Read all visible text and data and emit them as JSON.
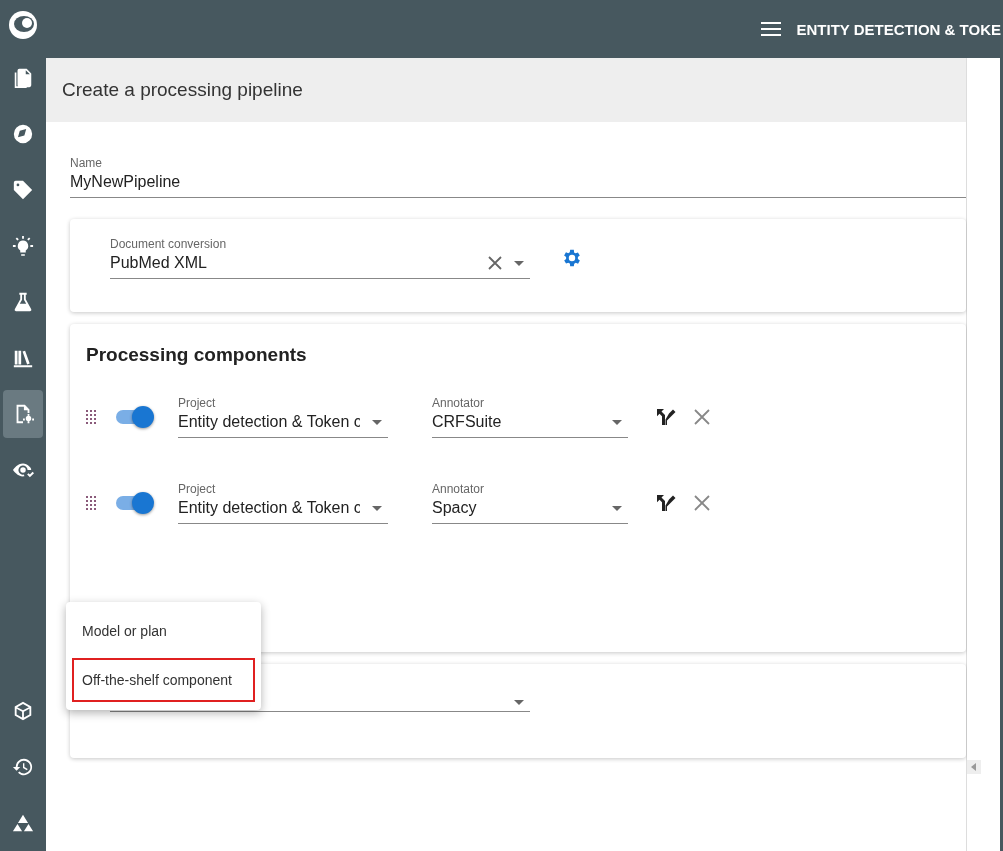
{
  "topbar": {
    "title": "ENTITY DETECTION & TOKE"
  },
  "sidebar": {
    "items": [
      {
        "kind": "document",
        "selected": false
      },
      {
        "kind": "compass",
        "selected": false
      },
      {
        "kind": "tag",
        "selected": false
      },
      {
        "kind": "bulb",
        "selected": false
      },
      {
        "kind": "flask",
        "selected": false
      },
      {
        "kind": "books",
        "selected": false
      },
      {
        "kind": "pipeline",
        "selected": true
      },
      {
        "kind": "eye",
        "selected": false
      }
    ],
    "bottom_items": [
      {
        "kind": "cube"
      },
      {
        "kind": "history"
      },
      {
        "kind": "triangles"
      }
    ]
  },
  "page": {
    "title": "Create a processing pipeline"
  },
  "name_field": {
    "label": "Name",
    "value": "MyNewPipeline"
  },
  "conversion": {
    "label": "Document conversion",
    "value": "PubMed XML"
  },
  "components": {
    "title": "Processing components",
    "rows": [
      {
        "on": true,
        "project_label": "Project",
        "project": "Entity detection & Token c",
        "annotator_label": "Annotator",
        "annotator": "CRFSuite"
      },
      {
        "on": true,
        "project_label": "Project",
        "project": "Entity detection & Token c",
        "annotator_label": "Annotator",
        "annotator": "Spacy"
      }
    ]
  },
  "menu": {
    "items": [
      {
        "label": "Model or plan",
        "highlighted": false
      },
      {
        "label": "Off-the-shelf component",
        "highlighted": true
      }
    ]
  }
}
